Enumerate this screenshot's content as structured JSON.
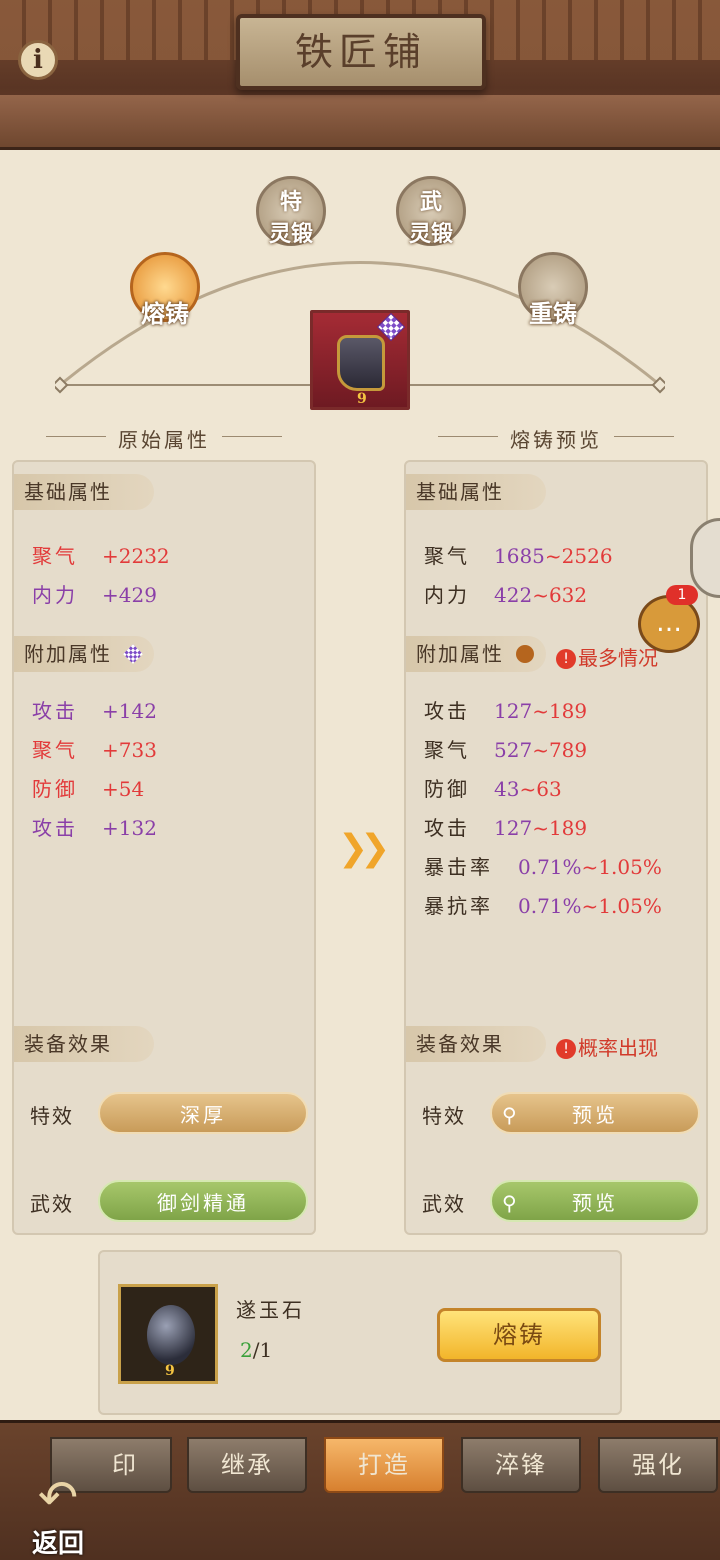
{
  "header": {
    "title": "铁匠铺",
    "info_icon": "i"
  },
  "modes": [
    {
      "label": "熔铸",
      "active": true
    },
    {
      "label": "灵锻",
      "top": "特"
    },
    {
      "label": "灵锻",
      "top": "武"
    },
    {
      "label": "重铸"
    }
  ],
  "equipment": {
    "level_mark": "9"
  },
  "left": {
    "section_title": "原始属性",
    "base_label": "基础属性",
    "base": [
      {
        "k": "聚气",
        "v": "+2232",
        "color": "red"
      },
      {
        "k": "内力",
        "v": "+429",
        "color": "purple"
      }
    ],
    "extra_label": "附加属性",
    "extra": [
      {
        "k": "攻击",
        "v": "+142",
        "color": "purple"
      },
      {
        "k": "聚气",
        "v": "+733",
        "color": "red"
      },
      {
        "k": "防御",
        "v": "+54",
        "color": "red"
      },
      {
        "k": "攻击",
        "v": "+132",
        "color": "purple"
      }
    ],
    "effect_label": "装备效果",
    "special_k": "特效",
    "special_v": "深厚",
    "martial_k": "武效",
    "martial_v": "御剑精通"
  },
  "right": {
    "section_title": "熔铸预览",
    "base_label": "基础属性",
    "base": [
      {
        "k": "聚气",
        "a": "1685",
        "b": "2526"
      },
      {
        "k": "内力",
        "a": "422",
        "b": "632"
      }
    ],
    "extra_label": "附加属性",
    "extra_warn": "最多情况",
    "extra": [
      {
        "k": "攻击",
        "a": "127",
        "b": "189"
      },
      {
        "k": "聚气",
        "a": "527",
        "b": "789"
      },
      {
        "k": "防御",
        "a": "43",
        "b": "63"
      },
      {
        "k": "攻击",
        "a": "127",
        "b": "189"
      },
      {
        "k": "暴击率",
        "a": "0.71%",
        "b": "1.05%"
      },
      {
        "k": "暴抗率",
        "a": "0.71%",
        "b": "1.05%"
      }
    ],
    "effect_label": "装备效果",
    "effect_warn": "概率出现",
    "special_k": "特效",
    "special_v": "预览",
    "martial_k": "武效",
    "martial_v": "预览"
  },
  "material": {
    "name": "遂玉石",
    "have": "2",
    "need": "/1",
    "level_mark": "9"
  },
  "action": {
    "label": "熔铸"
  },
  "chat": {
    "badge": "1"
  },
  "tabs": [
    {
      "label": "印"
    },
    {
      "label": "继承"
    },
    {
      "label": "打造",
      "selected": true
    },
    {
      "label": "淬锋"
    },
    {
      "label": "强化"
    }
  ],
  "back": {
    "label": "返回"
  }
}
